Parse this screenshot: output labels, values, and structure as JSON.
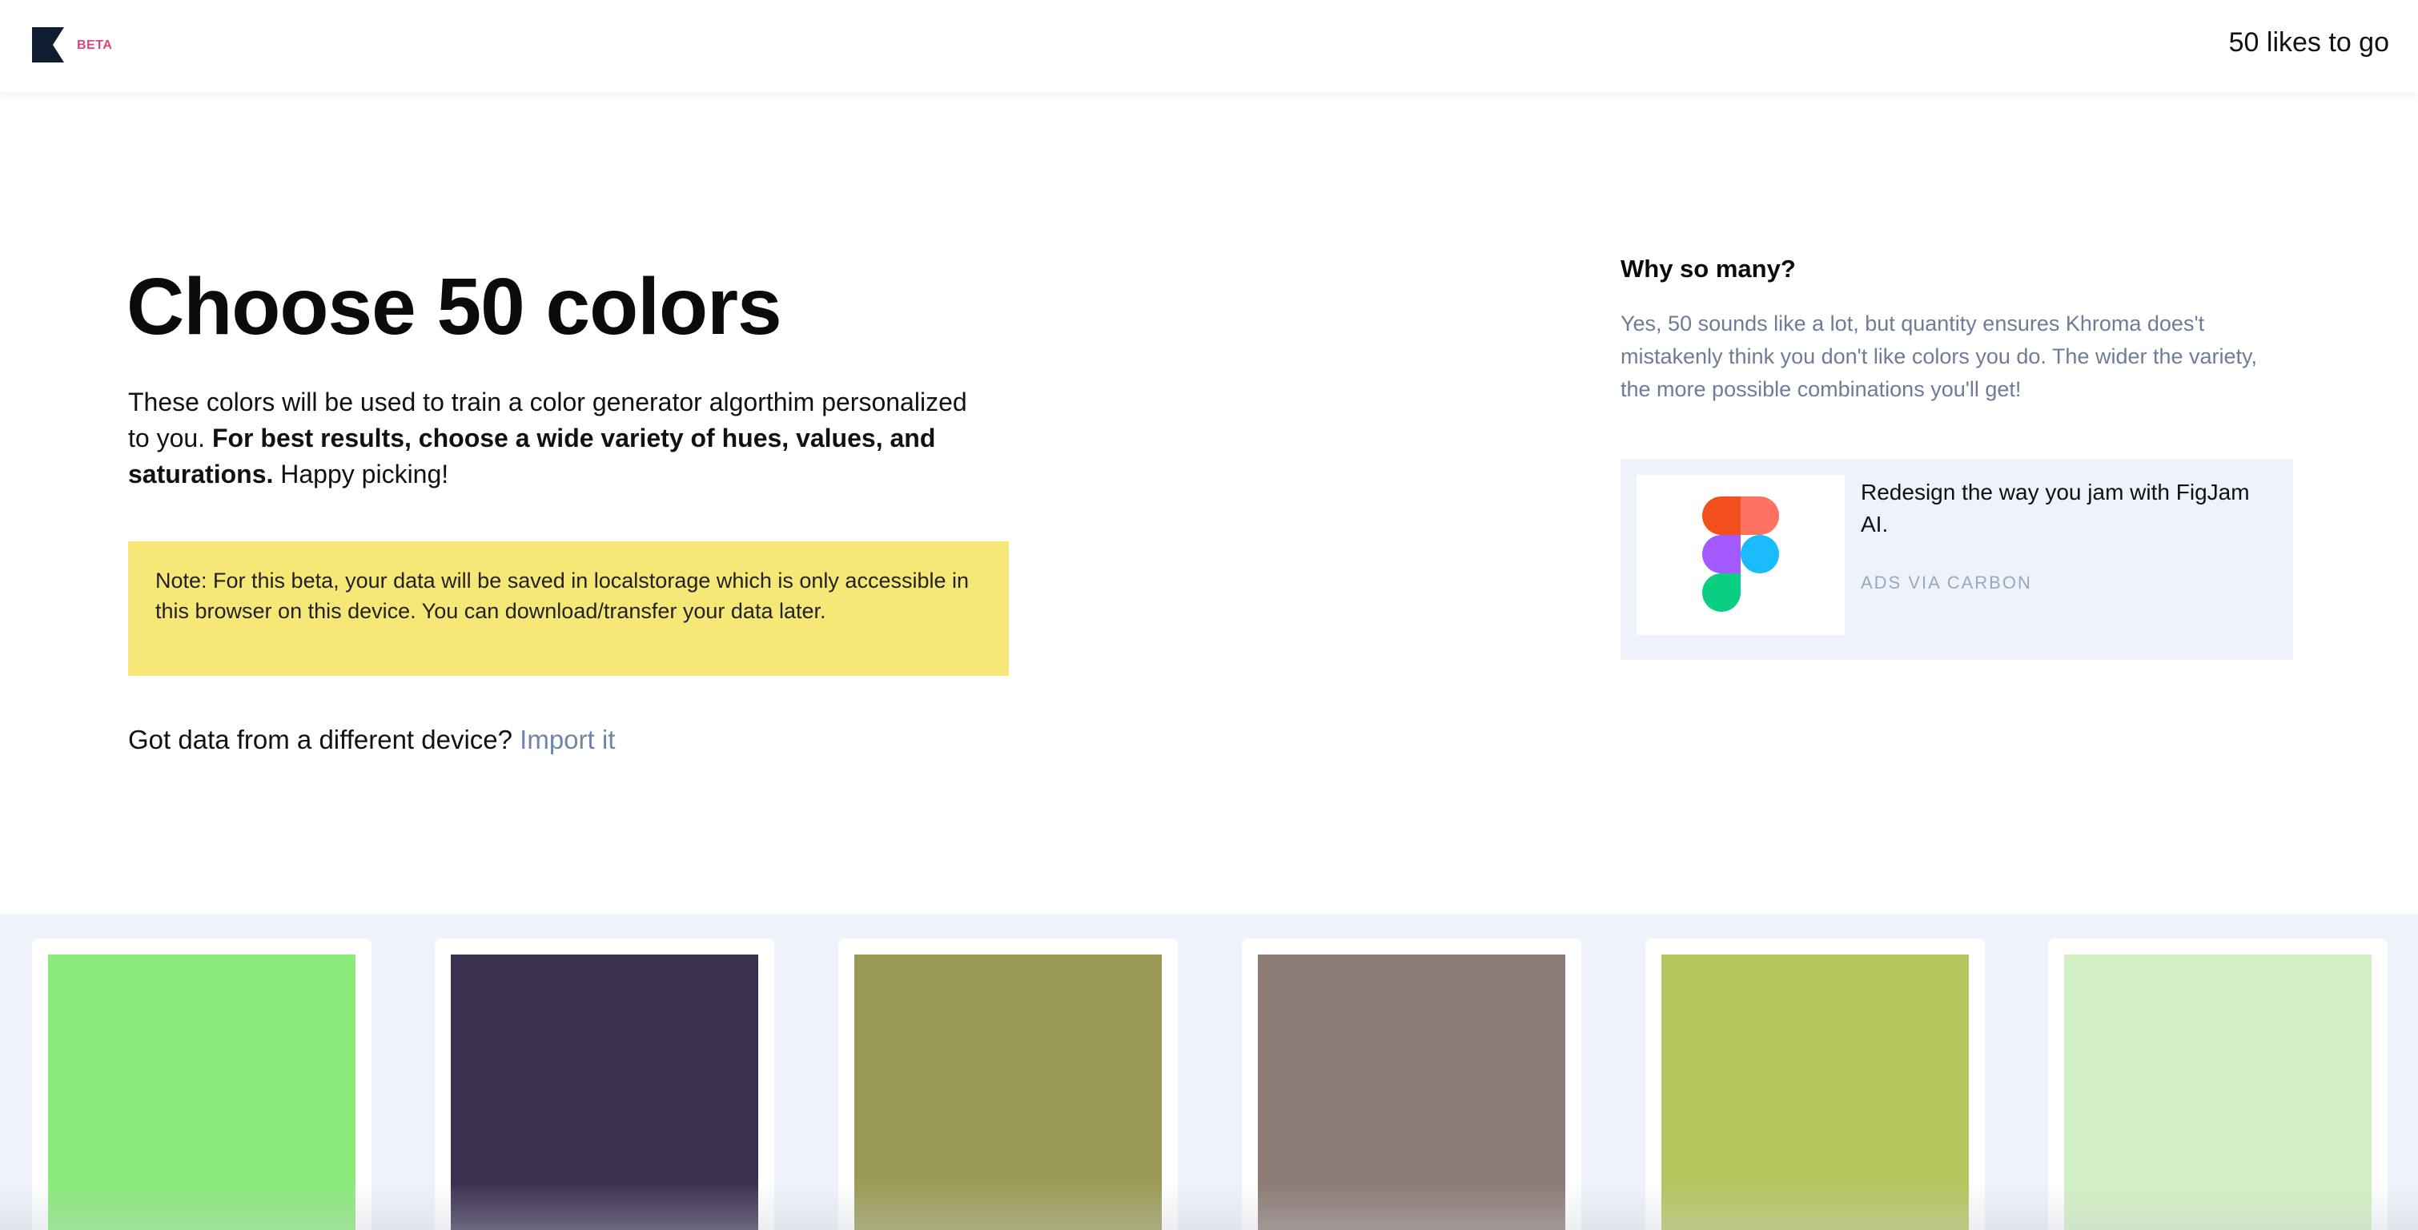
{
  "header": {
    "logo_icon": "khroma-k-logo-icon",
    "beta_label": "BETA",
    "beta_color": "#e0447a",
    "likes_to_go": "50 likes to go"
  },
  "main": {
    "title": "Choose 50 colors",
    "intro_plain": "These colors will be used to train a color generator algorthim personalized to you.",
    "intro_bold": "For best results, choose a wide variety of hues, values, and saturations.",
    "intro_end": "Happy picking!",
    "note": "Note: For this beta, your data will be saved in localstorage which is only accessible in this browser on this device. You can download/transfer your data later.",
    "import_prompt": "Got data from a different device?",
    "import_link": "Import it"
  },
  "sidebar": {
    "title": "Why so many?",
    "text": "Yes, 50 sounds like a lot, but quantity ensures Khroma does't mistakenly think you don't like colors you do. The wider the variety, the more possible combinations you'll get!"
  },
  "ad": {
    "image_icon": "figma-logo-icon",
    "text": "Redesign the way you jam with FigJam AI.",
    "via": "ADS VIA CARBON"
  },
  "colors": [
    "#8aea7a",
    "#3c3050",
    "#9b9a55",
    "#8c7b74",
    "#b6c65e",
    "#d3f0c4"
  ]
}
